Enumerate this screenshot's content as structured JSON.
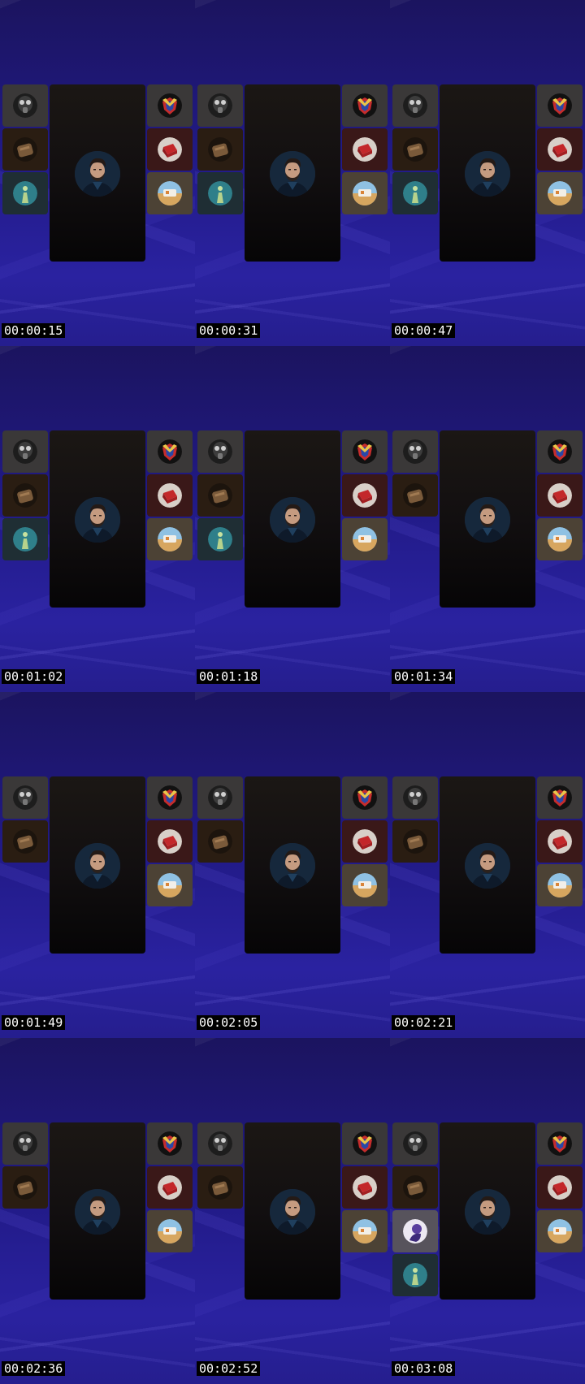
{
  "frames": [
    {
      "timestamp": "00:00:15",
      "left_tiles": [
        "gas-mask",
        "leather-bag",
        "figure-teal"
      ],
      "right_tiles": [
        "shield-emblem",
        "red-cube",
        "desert-scene"
      ]
    },
    {
      "timestamp": "00:00:31",
      "left_tiles": [
        "gas-mask",
        "leather-bag",
        "figure-teal"
      ],
      "right_tiles": [
        "shield-emblem",
        "red-cube",
        "desert-scene"
      ]
    },
    {
      "timestamp": "00:00:47",
      "left_tiles": [
        "gas-mask",
        "leather-bag",
        "figure-teal"
      ],
      "right_tiles": [
        "shield-emblem",
        "red-cube",
        "desert-scene"
      ]
    },
    {
      "timestamp": "00:01:02",
      "left_tiles": [
        "gas-mask",
        "leather-bag",
        "figure-teal"
      ],
      "right_tiles": [
        "shield-emblem",
        "red-cube",
        "desert-scene"
      ]
    },
    {
      "timestamp": "00:01:18",
      "left_tiles": [
        "gas-mask",
        "leather-bag",
        "figure-teal"
      ],
      "right_tiles": [
        "shield-emblem",
        "red-cube",
        "desert-scene"
      ]
    },
    {
      "timestamp": "00:01:34",
      "left_tiles": [
        "gas-mask",
        "leather-bag"
      ],
      "right_tiles": [
        "shield-emblem",
        "red-cube",
        "desert-scene"
      ]
    },
    {
      "timestamp": "00:01:49",
      "left_tiles": [
        "gas-mask",
        "leather-bag"
      ],
      "right_tiles": [
        "shield-emblem",
        "red-cube",
        "desert-scene"
      ]
    },
    {
      "timestamp": "00:02:05",
      "left_tiles": [
        "gas-mask",
        "leather-bag"
      ],
      "right_tiles": [
        "shield-emblem",
        "red-cube",
        "desert-scene"
      ]
    },
    {
      "timestamp": "00:02:21",
      "left_tiles": [
        "gas-mask",
        "leather-bag"
      ],
      "right_tiles": [
        "shield-emblem",
        "red-cube",
        "desert-scene"
      ]
    },
    {
      "timestamp": "00:02:36",
      "left_tiles": [
        "gas-mask",
        "leather-bag"
      ],
      "right_tiles": [
        "shield-emblem",
        "red-cube",
        "desert-scene"
      ]
    },
    {
      "timestamp": "00:02:52",
      "left_tiles": [
        "gas-mask",
        "leather-bag"
      ],
      "right_tiles": [
        "shield-emblem",
        "red-cube",
        "desert-scene"
      ]
    },
    {
      "timestamp": "00:03:08",
      "left_tiles": [
        "gas-mask",
        "leather-bag",
        "purple-figure",
        "figure-teal"
      ],
      "right_tiles": [
        "shield-emblem",
        "red-cube",
        "desert-scene"
      ]
    }
  ],
  "colors": {
    "background": "#1a1470",
    "main_tile": "#120f10",
    "timestamp_bg": "#000000",
    "timestamp_text": "#ffffff"
  }
}
